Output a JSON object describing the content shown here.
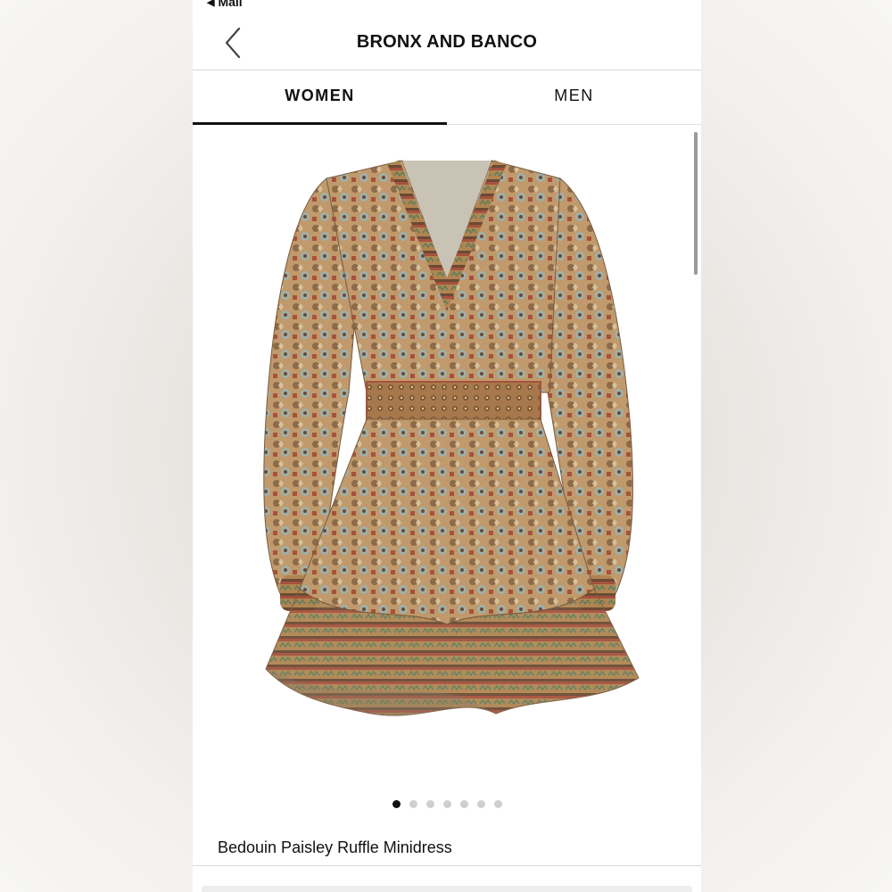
{
  "status": {
    "back_app": "Mail"
  },
  "header": {
    "title": "BRONX AND BANCO"
  },
  "tabs": [
    {
      "label": "WOMEN",
      "active": true
    },
    {
      "label": "MEN",
      "active": false
    }
  ],
  "gallery": {
    "image_count": 7,
    "current_index": 1
  },
  "product": {
    "name": "Bedouin Paisley Ruffle Minidress"
  },
  "colors": {
    "dress_base": "#b8946a",
    "dress_dark": "#6b4a34",
    "rust": "#a5523d",
    "teal": "#6f8f8a"
  }
}
